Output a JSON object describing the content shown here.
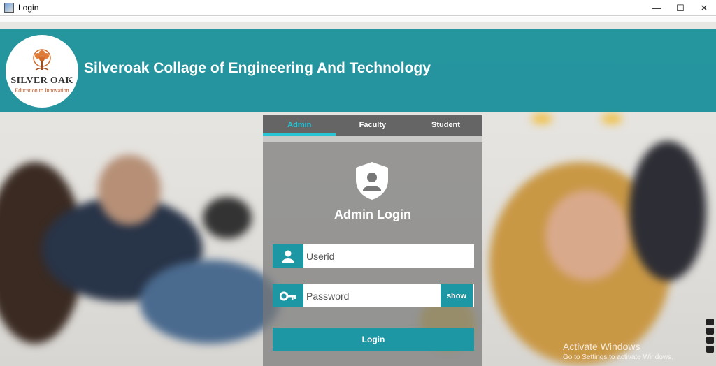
{
  "window": {
    "title": "Login",
    "controls": [
      "—",
      "☐",
      "✕"
    ]
  },
  "header": {
    "logo_brand": "SILVER OAK",
    "logo_tagline": "Education to Innovation",
    "college_name": "Silveroak Collage of Engineering And Technology"
  },
  "tabs": [
    {
      "label": "Admin",
      "active": true
    },
    {
      "label": "Faculty",
      "active": false
    },
    {
      "label": "Student",
      "active": false
    }
  ],
  "login": {
    "title": "Admin Login",
    "userid_placeholder": "Userid",
    "password_placeholder": "Password",
    "show_label": "show",
    "button_label": "Login"
  },
  "watermark": {
    "line1": "Activate Windows",
    "line2": "Go to Settings to activate Windows."
  },
  "colors": {
    "accent": "#1d97a3",
    "banner": "#168e99",
    "active_tab": "#27c5d6"
  }
}
